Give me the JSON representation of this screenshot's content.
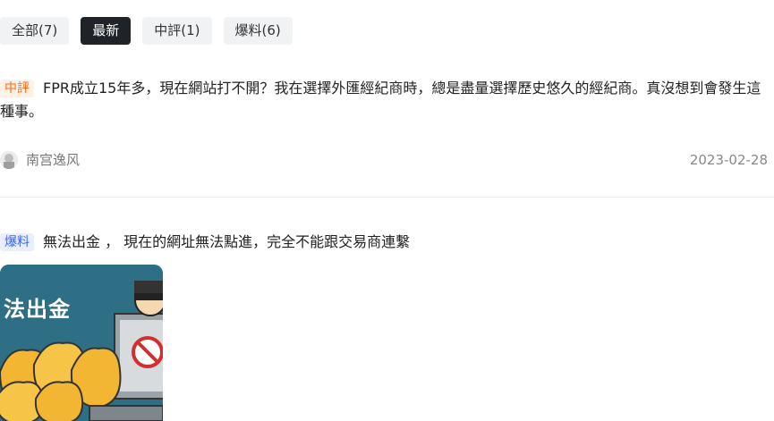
{
  "tabs": [
    {
      "label": "全部(7)",
      "active": false
    },
    {
      "label": "最新",
      "active": true
    },
    {
      "label": "中評(1)",
      "active": false
    },
    {
      "label": "爆料(6)",
      "active": false
    }
  ],
  "reviews": [
    {
      "tag": "中評",
      "text": "FPR成立15年多，現在網站打不開？我在選擇外匯經紀商時，總是盡量選擇歷史悠久的經紀商。真沒想到會發生這種事。",
      "author": "南宫逸风",
      "date": "2023-02-28"
    },
    {
      "tag": "爆料",
      "text": "無法出金 ， 現在的網址無法點進，完全不能跟交易商連繫",
      "image_caption": "法出金"
    }
  ],
  "colors": {
    "active_tab_bg": "#1f2328",
    "tag_mid": "#ff6a14",
    "tag_leak": "#3b62f0"
  }
}
